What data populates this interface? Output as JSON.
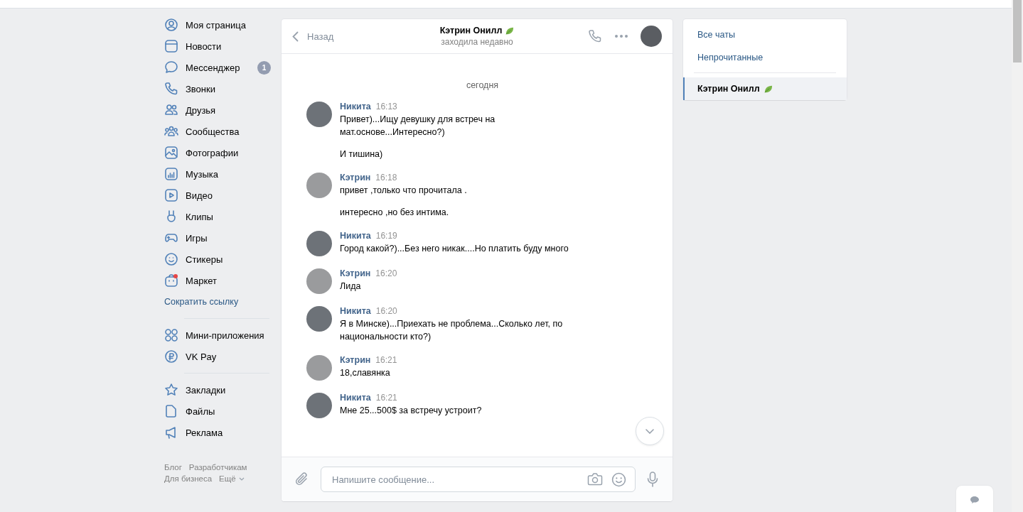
{
  "nav": {
    "items": [
      {
        "label": "Моя страница"
      },
      {
        "label": "Новости"
      },
      {
        "label": "Мессенджер",
        "badge": "1"
      },
      {
        "label": "Звонки"
      },
      {
        "label": "Друзья"
      },
      {
        "label": "Сообщества"
      },
      {
        "label": "Фотографии"
      },
      {
        "label": "Музыка"
      },
      {
        "label": "Видео"
      },
      {
        "label": "Клипы"
      },
      {
        "label": "Игры"
      },
      {
        "label": "Стикеры"
      },
      {
        "label": "Маркет",
        "notification": true
      }
    ],
    "link": "Сократить ссылку",
    "apps": [
      {
        "label": "Мини-приложения"
      },
      {
        "label": "VK Pay"
      }
    ],
    "extra": [
      {
        "label": "Закладки"
      },
      {
        "label": "Файлы"
      },
      {
        "label": "Реклама"
      }
    ],
    "footer": [
      "Блог",
      "Разработчикам",
      "Для бизнеса",
      "Ещё"
    ]
  },
  "chat": {
    "back": "Назад",
    "title": "Кэтрин Онилл",
    "status": "заходила недавно",
    "date": "сегодня",
    "groups": [
      {
        "author": "Никита",
        "time": "16:13",
        "messages": [
          "Привет)...Ищу девушку для встреч на мат.основе...Интересно?)",
          "И тишина)"
        ]
      },
      {
        "author": "Кэтрин",
        "time": "16:18",
        "messages": [
          "привет ,только что прочитала .",
          "интересно ,но без интима."
        ]
      },
      {
        "author": "Никита",
        "time": "16:19",
        "messages": [
          "Город какой?)...Без него никак....Но платить буду много"
        ]
      },
      {
        "author": "Кэтрин",
        "time": "16:20",
        "messages": [
          "Лида"
        ]
      },
      {
        "author": "Никита",
        "time": "16:20",
        "messages": [
          "Я в Минске)...Приехать не проблема...Сколько лет, по национальности кто?)"
        ]
      },
      {
        "author": "Кэтрин",
        "time": "16:21",
        "messages": [
          "18,славянка"
        ]
      },
      {
        "author": "Никита",
        "time": "16:21",
        "messages": [
          "Мне 25...500$ за встречу устроит?"
        ]
      }
    ],
    "input": {
      "placeholder": "Напишите сообщение..."
    }
  },
  "folders": {
    "items": [
      {
        "label": "Все чаты",
        "selected": false
      },
      {
        "label": "Непрочитанные",
        "selected": false
      }
    ],
    "chats": [
      {
        "label": "Кэтрин Онилл",
        "selected": true
      }
    ]
  }
}
